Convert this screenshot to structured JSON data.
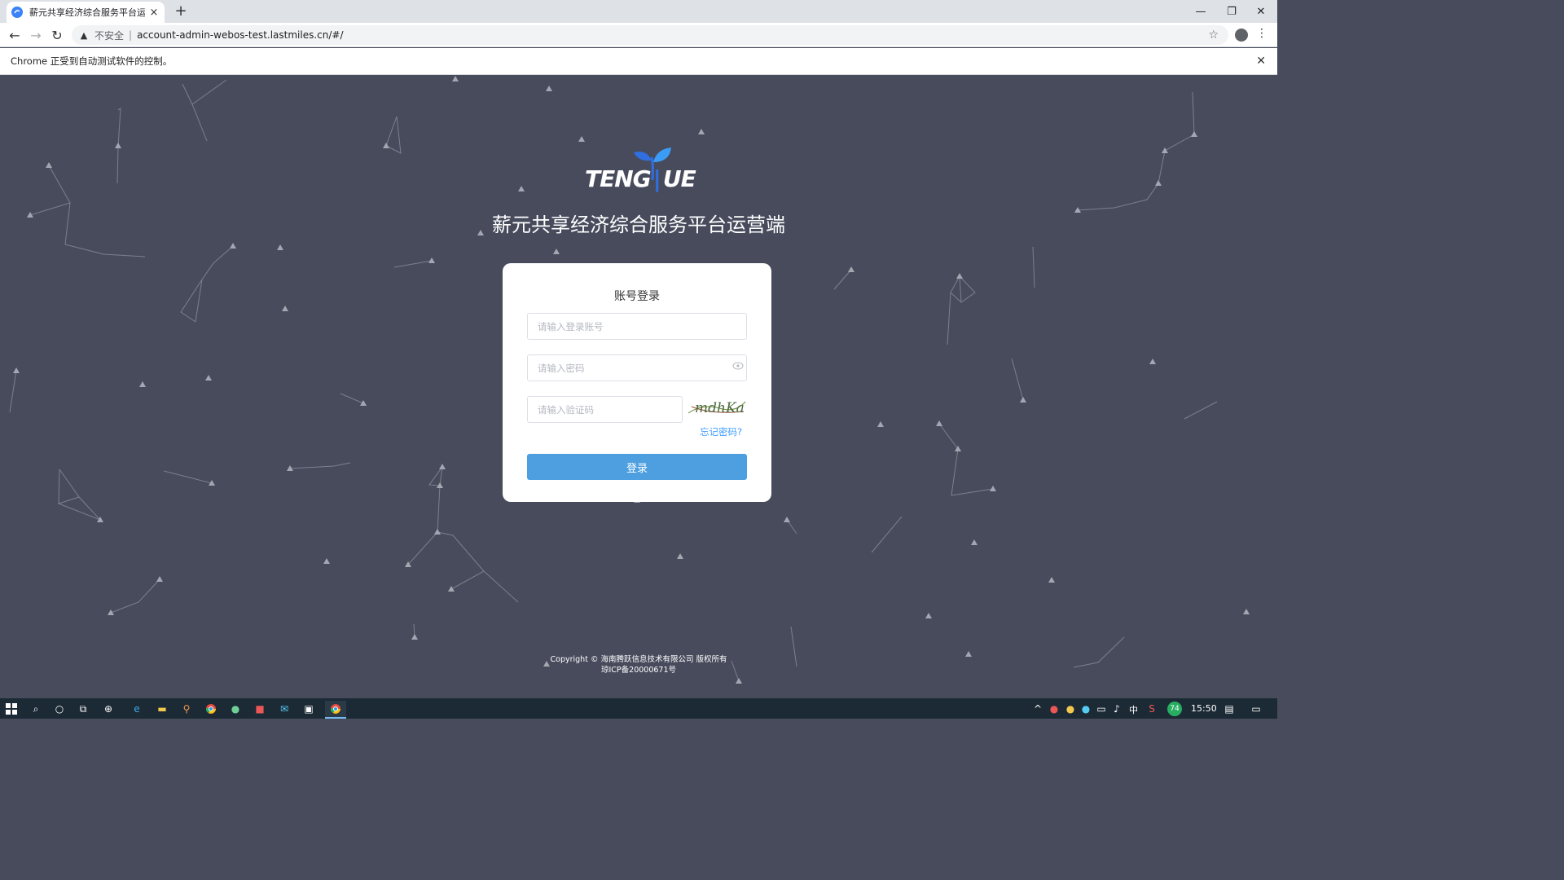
{
  "browser": {
    "tab_title": "薪元共享经济综合服务平台运营端",
    "tab_close": "×",
    "new_tab": "+",
    "window_controls": {
      "minimize": "—",
      "restore": "❐",
      "close": "✕"
    },
    "nav": {
      "back": "←",
      "forward": "→",
      "reload": "↻"
    },
    "security_label": "不安全",
    "url": "account-admin-webos-test.lastmiles.cn/#/",
    "infobar_text": "Chrome 正受到自动测试软件的控制。",
    "infobar_close": "✕"
  },
  "logo": {
    "text": "TENG UE",
    "brand_color": "#3b82f6"
  },
  "page": {
    "title": "薪元共享经济综合服务平台运营端",
    "background_color": "#474b5c"
  },
  "login": {
    "heading": "账号登录",
    "account_placeholder": "请输入登录账号",
    "password_placeholder": "请输入密码",
    "captcha_placeholder": "请输入验证码",
    "captcha_text": "mdhKa",
    "forgot_password": "忘记密码?",
    "submit_label": "登录",
    "button_color": "#4d9fe0"
  },
  "footer": {
    "copyright": "Copyright © 海南腾跃信息技术有限公司 版权所有",
    "icp": "琼ICP备20000671号"
  },
  "taskbar": {
    "tray": {
      "ime": "中",
      "badge": "74",
      "time": "15:50"
    }
  }
}
